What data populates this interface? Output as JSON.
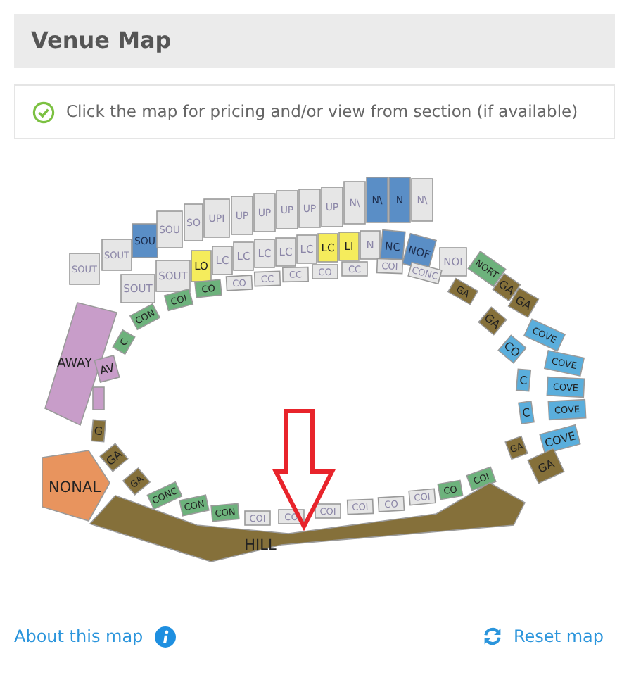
{
  "header": {
    "title": "Venue Map"
  },
  "info": {
    "text": "Click the map for pricing and/or view from section (if available)"
  },
  "sections": [
    {
      "label": "SOUT",
      "color": "#e6e6e6"
    },
    {
      "label": "SOUT",
      "color": "#e6e6e6"
    },
    {
      "label": "SOU",
      "color": "#5a8ec6"
    },
    {
      "label": "SOU",
      "color": "#e6e6e6"
    },
    {
      "label": "SO",
      "color": "#e6e6e6"
    },
    {
      "label": "UPI",
      "color": "#e6e6e6"
    },
    {
      "label": "UP",
      "color": "#e6e6e6"
    },
    {
      "label": "UP",
      "color": "#e6e6e6"
    },
    {
      "label": "UP",
      "color": "#e6e6e6"
    },
    {
      "label": "UP",
      "color": "#e6e6e6"
    },
    {
      "label": "UP",
      "color": "#e6e6e6"
    },
    {
      "label": "N\\",
      "color": "#e6e6e6"
    },
    {
      "label": "N\\",
      "color": "#5a8ec6"
    },
    {
      "label": "N",
      "color": "#5a8ec6"
    },
    {
      "label": "N\\",
      "color": "#e6e6e6"
    },
    {
      "label": "SOUT",
      "color": "#e6e6e6"
    },
    {
      "label": "SOUT",
      "color": "#e6e6e6"
    },
    {
      "label": "LO",
      "color": "#f5ec5c"
    },
    {
      "label": "LC",
      "color": "#e6e6e6"
    },
    {
      "label": "LC",
      "color": "#e6e6e6"
    },
    {
      "label": "LC",
      "color": "#e6e6e6"
    },
    {
      "label": "LC",
      "color": "#e6e6e6"
    },
    {
      "label": "LC",
      "color": "#e6e6e6"
    },
    {
      "label": "LC",
      "color": "#f5ec5c"
    },
    {
      "label": "LI",
      "color": "#f5ec5c"
    },
    {
      "label": "N",
      "color": "#e6e6e6"
    },
    {
      "label": "NC",
      "color": "#5a8ec6"
    },
    {
      "label": "NOF",
      "color": "#5a8ec6"
    },
    {
      "label": "NOI",
      "color": "#e6e6e6"
    },
    {
      "label": "CON",
      "color": "#6db27c"
    },
    {
      "label": "COI",
      "color": "#6db27c"
    },
    {
      "label": "CO",
      "color": "#6db27c"
    },
    {
      "label": "CO",
      "color": "#e6e6e6"
    },
    {
      "label": "CC",
      "color": "#e6e6e6"
    },
    {
      "label": "CC",
      "color": "#e6e6e6"
    },
    {
      "label": "CO",
      "color": "#e6e6e6"
    },
    {
      "label": "CC",
      "color": "#e6e6e6"
    },
    {
      "label": "COI",
      "color": "#e6e6e6"
    },
    {
      "label": "CONC",
      "color": "#e6e6e6"
    },
    {
      "label": "GA",
      "color": "#85703a"
    },
    {
      "label": "NORT",
      "color": "#6db27c"
    },
    {
      "label": "GA",
      "color": "#85703a"
    },
    {
      "label": "GA",
      "color": "#85703a"
    },
    {
      "label": "GA",
      "color": "#85703a"
    },
    {
      "label": "COVE",
      "color": "#5aaedc"
    },
    {
      "label": "CO",
      "color": "#5aaedc"
    },
    {
      "label": "COVE",
      "color": "#5aaedc"
    },
    {
      "label": "C",
      "color": "#5aaedc"
    },
    {
      "label": "COVE",
      "color": "#5aaedc"
    },
    {
      "label": "COVE",
      "color": "#5aaedc"
    },
    {
      "label": "C",
      "color": "#5aaedc"
    },
    {
      "label": "COVE",
      "color": "#5aaedc"
    },
    {
      "label": "GA",
      "color": "#85703a"
    },
    {
      "label": "GA",
      "color": "#85703a"
    },
    {
      "label": "AWAY",
      "color": "#c89dc9"
    },
    {
      "label": "C",
      "color": "#6db27c"
    },
    {
      "label": "AV",
      "color": "#c89dc9"
    },
    {
      "color": "#c89dc9"
    },
    {
      "label": "G",
      "color": "#85703a"
    },
    {
      "label": "GA",
      "color": "#85703a"
    },
    {
      "label": "GA",
      "color": "#85703a"
    },
    {
      "label": "CONC",
      "color": "#6db27c"
    },
    {
      "label": "CON",
      "color": "#6db27c"
    },
    {
      "label": "CON",
      "color": "#6db27c"
    },
    {
      "label": "COI",
      "color": "#e6e6e6"
    },
    {
      "label": "CO",
      "color": "#e6e6e6"
    },
    {
      "label": "COI",
      "color": "#e6e6e6"
    },
    {
      "label": "COI",
      "color": "#e6e6e6"
    },
    {
      "label": "CO",
      "color": "#e6e6e6"
    },
    {
      "label": "COI",
      "color": "#e6e6e6"
    },
    {
      "label": "CO",
      "color": "#6db27c"
    },
    {
      "label": "COI",
      "color": "#6db27c"
    },
    {
      "label": "NONAL",
      "color": "#e8945e"
    },
    {
      "label": "HILL",
      "color": "#85703a"
    }
  ],
  "footer": {
    "about_link": "About this map",
    "reset_link": "Reset map"
  }
}
